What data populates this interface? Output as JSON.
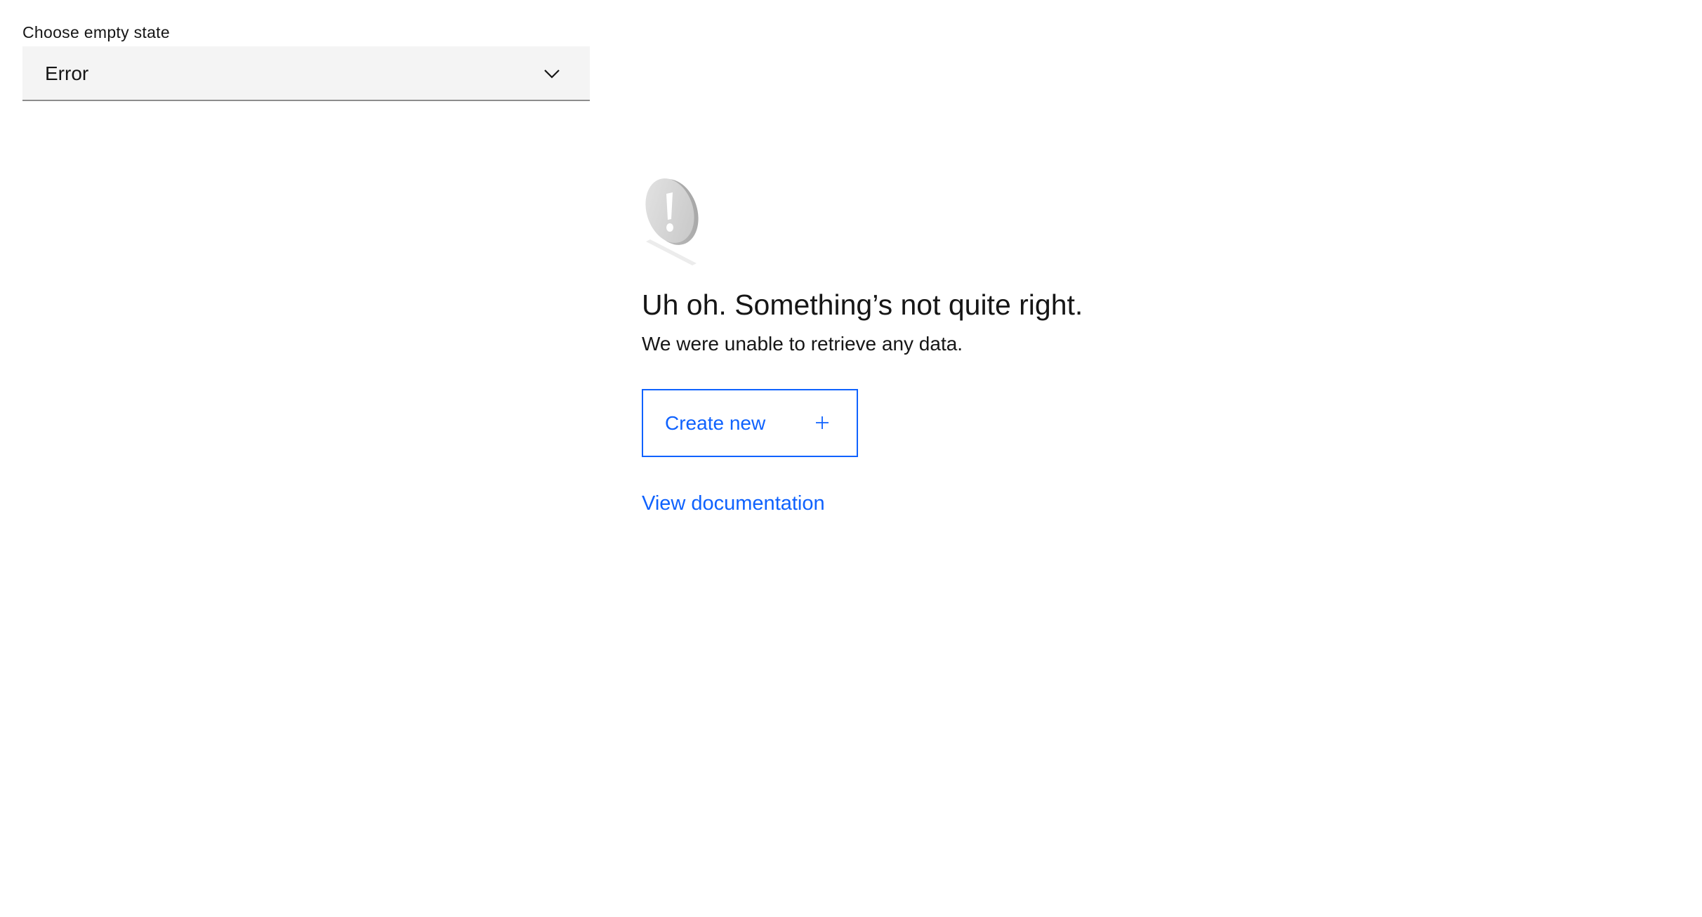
{
  "selector": {
    "label": "Choose empty state",
    "value": "Error",
    "icon": "chevron-down-icon"
  },
  "empty_state": {
    "illustration": "error-exclamation-icon",
    "title": "Uh oh. Something’s not quite right.",
    "subtitle": "We were unable to retrieve any data.",
    "primary_action": {
      "label": "Create new",
      "icon": "plus-icon"
    },
    "link": {
      "label": "View documentation"
    }
  },
  "colors": {
    "accent": "#0f62fe",
    "field_bg": "#f4f4f4",
    "text": "#161616"
  }
}
